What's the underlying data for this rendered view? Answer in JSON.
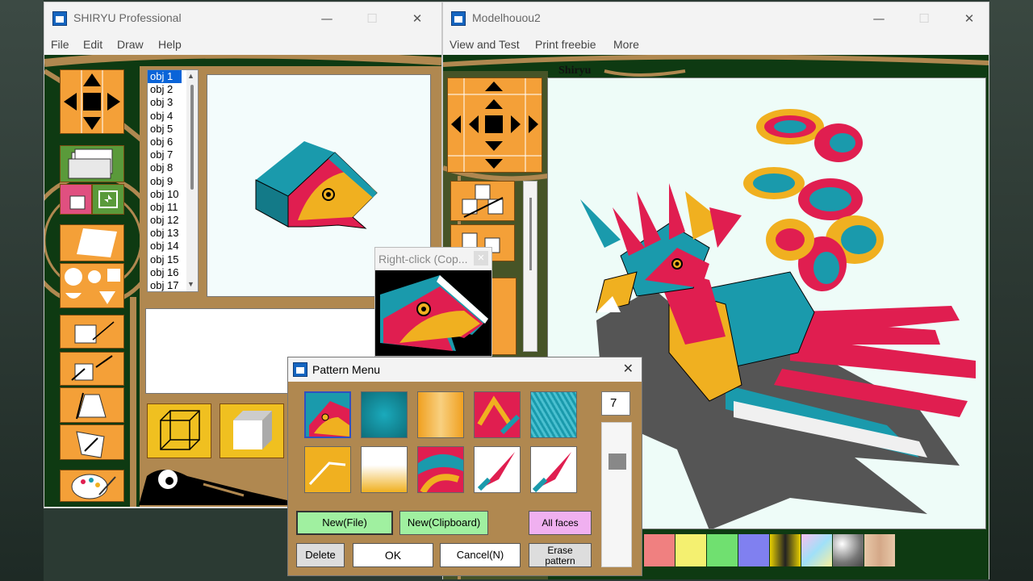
{
  "win_left": {
    "title": "SHIRYU Professional",
    "menu": [
      "File",
      "Edit",
      "Draw",
      "Help"
    ]
  },
  "win_right": {
    "title": "Modelhouou2",
    "menu": [
      "View and Test",
      "Print freebie",
      "More"
    ],
    "canvas_label": "Shiryu"
  },
  "objects": [
    "obj 1",
    "obj 2",
    "obj 3",
    "obj 4",
    "obj 5",
    "obj 6",
    "obj 7",
    "obj 8",
    "obj 9",
    "obj 10",
    "obj 11",
    "obj 12",
    "obj 13",
    "obj 14",
    "obj 15",
    "obj 16",
    "obj 17"
  ],
  "selected_object": "obj 1",
  "popup": {
    "title": "Right-click (Cop..."
  },
  "pattern_menu": {
    "title": "Pattern Menu",
    "count": "7",
    "new_file": "New(File)",
    "new_clipboard": "New(Clipboard)",
    "all_faces": "All faces",
    "delete": "Delete",
    "ok": "OK",
    "cancel": "Cancel(N)",
    "erase_line1": "Erase",
    "erase_line2": "pattern"
  },
  "colors": {
    "green_frame": "#0e3a12",
    "brown": "#b08850",
    "orange": "#f4a038",
    "teal": "#1a9aac",
    "red": "#e01e50",
    "yellow": "#f0b020"
  }
}
